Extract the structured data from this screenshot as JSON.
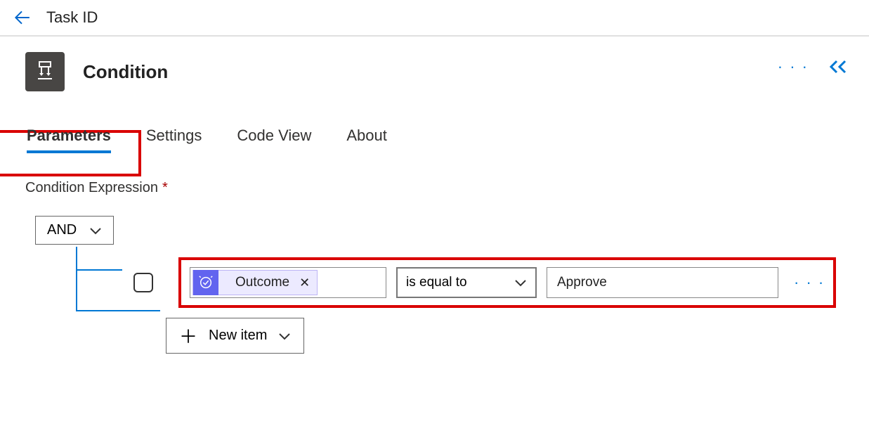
{
  "topbar": {
    "title": "Task ID"
  },
  "panel": {
    "title": "Condition"
  },
  "tabs": {
    "parameters": "Parameters",
    "settings": "Settings",
    "codeview": "Code View",
    "about": "About",
    "active": "parameters"
  },
  "condition": {
    "label": "Condition Expression",
    "required_mark": "*",
    "logic_operator": "AND",
    "row": {
      "field_token": "Outcome",
      "operator": "is equal to",
      "value": "Approve"
    },
    "new_item_label": "New item"
  },
  "icons": {
    "back": "back-arrow-icon",
    "condition": "condition-flow-icon",
    "more": "more-dots-icon",
    "collapse": "collapse-chevrons-icon",
    "chevron_down": "chevron-down-icon",
    "plus": "plus-icon",
    "remove": "remove-x-icon",
    "token": "dynamic-content-icon"
  },
  "colors": {
    "accent": "#0078d4",
    "danger_highlight": "#d90000",
    "token_bg": "#eceaff",
    "token_icon_bg": "#6264ef",
    "icon_bg": "#484644"
  }
}
